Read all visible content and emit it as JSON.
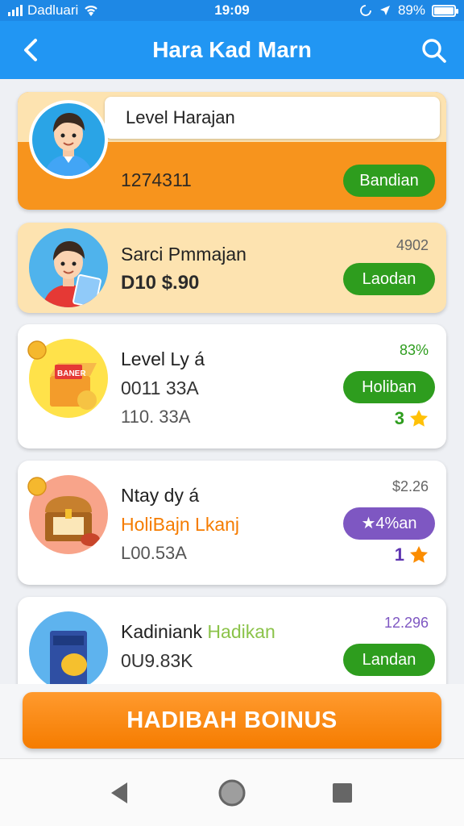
{
  "status_bar": {
    "carrier": "Dadluari",
    "time": "19:09",
    "battery": "89%",
    "battery_level": 0.89
  },
  "app_bar": {
    "title": "Hara Kad Marn"
  },
  "cards": [
    {
      "name_field": "Level Harajan",
      "value": "1274311",
      "button": "Bandian"
    },
    {
      "title": "Sarci Pmmajan",
      "amount": "D10 $.90",
      "corner": "4902",
      "button": "Laodan"
    },
    {
      "title": "Level Ly á",
      "line1": "0011 33A",
      "line2": "110. 33A",
      "corner": "83%",
      "button": "Holiban",
      "stars": "3"
    },
    {
      "title": "Ntay dy á",
      "subtitle": "HoliBajn Lkanj",
      "line2": "L00.53A",
      "corner": "$2.26",
      "button": "★4%an",
      "stars": "1"
    },
    {
      "title": "Kadiniank",
      "title_highlight": "Hadikan",
      "line1": "0U9.83K",
      "corner": "12.296",
      "button": "Landan"
    }
  ],
  "bonus_button": "HADIBAH BOINUS",
  "colors": {
    "primary_blue": "#2196f3",
    "orange": "#f7941d",
    "green": "#2e9d1e",
    "purple": "#7e57c2",
    "cream": "#fde3b0"
  },
  "icons": [
    "back-arrow-icon",
    "search-icon",
    "wifi-icon",
    "location-arrow-icon",
    "star-icon",
    "coin-icon",
    "nav-back-icon",
    "nav-home-icon",
    "nav-recents-icon"
  ]
}
